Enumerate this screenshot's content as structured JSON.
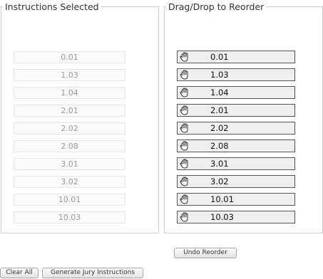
{
  "left_panel": {
    "legend": "Instructions Selected",
    "items": [
      "0.01",
      "1.03",
      "1.04",
      "2.01",
      "2.02",
      "2.08",
      "3.01",
      "3.02",
      "10.01",
      "10.03"
    ]
  },
  "right_panel": {
    "legend": "Drag/Drop to Reorder",
    "items": [
      "0.01",
      "1.03",
      "1.04",
      "2.01",
      "2.02",
      "2.08",
      "3.01",
      "3.02",
      "10.01",
      "10.03"
    ],
    "drag_icon": "grab-hand-icon"
  },
  "buttons": {
    "undo": "Undo Reorder",
    "clear": "Clear All",
    "generate": "Generate Jury Instructions"
  }
}
